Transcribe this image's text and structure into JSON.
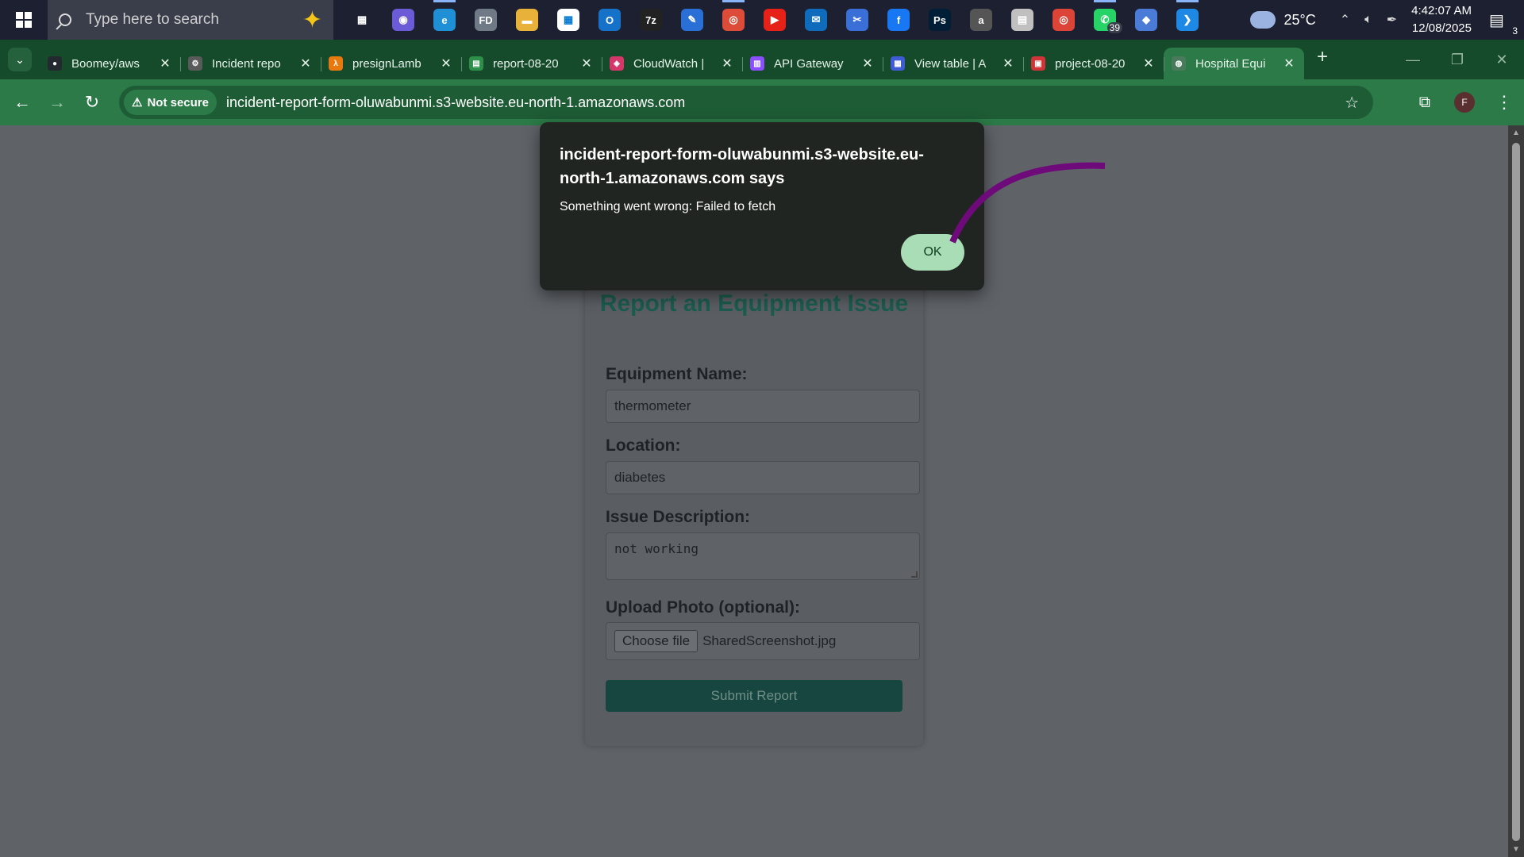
{
  "taskbar": {
    "search_placeholder": "Type here to search",
    "apps": [
      {
        "name": "task-view",
        "color": "#1c2030",
        "glyph": "▦"
      },
      {
        "name": "copilot",
        "color": "#6b5bd6",
        "glyph": "◉"
      },
      {
        "name": "edge",
        "color": "#1f8fd6",
        "glyph": "e"
      },
      {
        "name": "files-app",
        "color": "#6f7a86",
        "glyph": "FD"
      },
      {
        "name": "file-explorer",
        "color": "#e8b23a",
        "glyph": "▬"
      },
      {
        "name": "ms-store",
        "color": "#ffffff",
        "glyph": "▦"
      },
      {
        "name": "outlook",
        "color": "#1572c8",
        "glyph": "O"
      },
      {
        "name": "7zip",
        "color": "#222222",
        "glyph": "7z"
      },
      {
        "name": "paint-app",
        "color": "#2a6fd6",
        "glyph": "✎"
      },
      {
        "name": "chrome",
        "color": "#dd4b39",
        "glyph": "◎"
      },
      {
        "name": "youtube",
        "color": "#e62117",
        "glyph": "▶"
      },
      {
        "name": "outlook-mail",
        "color": "#0f6cbd",
        "glyph": "✉"
      },
      {
        "name": "snip-tool",
        "color": "#3b6fd8",
        "glyph": "✂"
      },
      {
        "name": "facebook",
        "color": "#1877f2",
        "glyph": "f"
      },
      {
        "name": "photoshop",
        "color": "#001e36",
        "glyph": "Ps"
      },
      {
        "name": "amazon",
        "color": "#555555",
        "glyph": "a"
      },
      {
        "name": "photos",
        "color": "#c0c0c0",
        "glyph": "▤"
      },
      {
        "name": "chrome-profile",
        "color": "#db4437",
        "glyph": "◎"
      },
      {
        "name": "whatsapp",
        "color": "#25d366",
        "glyph": "✆",
        "badge": "39"
      },
      {
        "name": "git-tool",
        "color": "#4a7bd6",
        "glyph": "◆"
      },
      {
        "name": "vscode",
        "color": "#1e88e5",
        "glyph": "❯"
      }
    ],
    "weather": "25°C",
    "time": "4:42:07 AM",
    "date": "12/08/2025",
    "notifications": "3"
  },
  "browser": {
    "tabs": [
      {
        "title": "Boomey/aws",
        "favicon_color": "#24292f",
        "favicon": "●"
      },
      {
        "title": "Incident repo",
        "favicon_color": "#5a5a5a",
        "favicon": "⚙"
      },
      {
        "title": "presignLamb",
        "favicon_color": "#e8790e",
        "favicon": "λ"
      },
      {
        "title": "report-08-20",
        "favicon_color": "#2d8f4a",
        "favicon": "▤"
      },
      {
        "title": "CloudWatch |",
        "favicon_color": "#d6376a",
        "favicon": "◈"
      },
      {
        "title": "API Gateway",
        "favicon_color": "#8c4fff",
        "favicon": "▥"
      },
      {
        "title": "View table | A",
        "favicon_color": "#3f5bd6",
        "favicon": "▦"
      },
      {
        "title": "project-08-20",
        "favicon_color": "#d13438",
        "favicon": "▣"
      },
      {
        "title": "Hospital Equi",
        "favicon_color": "#4a7a5c",
        "favicon": "◍",
        "active": true
      }
    ],
    "url": "incident-report-form-oluwabunmi.s3-website.eu-north-1.amazonaws.com",
    "security_chip": "Not secure",
    "profile_initial": "F"
  },
  "form": {
    "title": "Report an Equipment Issue",
    "equipment_label": "Equipment Name:",
    "equipment_value": "thermometer",
    "location_label": "Location:",
    "location_value": "diabetes",
    "description_label": "Issue Description:",
    "description_value": "not working",
    "photo_label": "Upload Photo (optional):",
    "choose_file": "Choose file",
    "file_name": "SharedScreenshot.jpg",
    "submit": "Submit Report"
  },
  "dialog": {
    "title": "incident-report-form-oluwabunmi.s3-website.eu-north-1.amazonaws.com says",
    "message": "Something went wrong: Failed to fetch",
    "ok": "OK"
  }
}
